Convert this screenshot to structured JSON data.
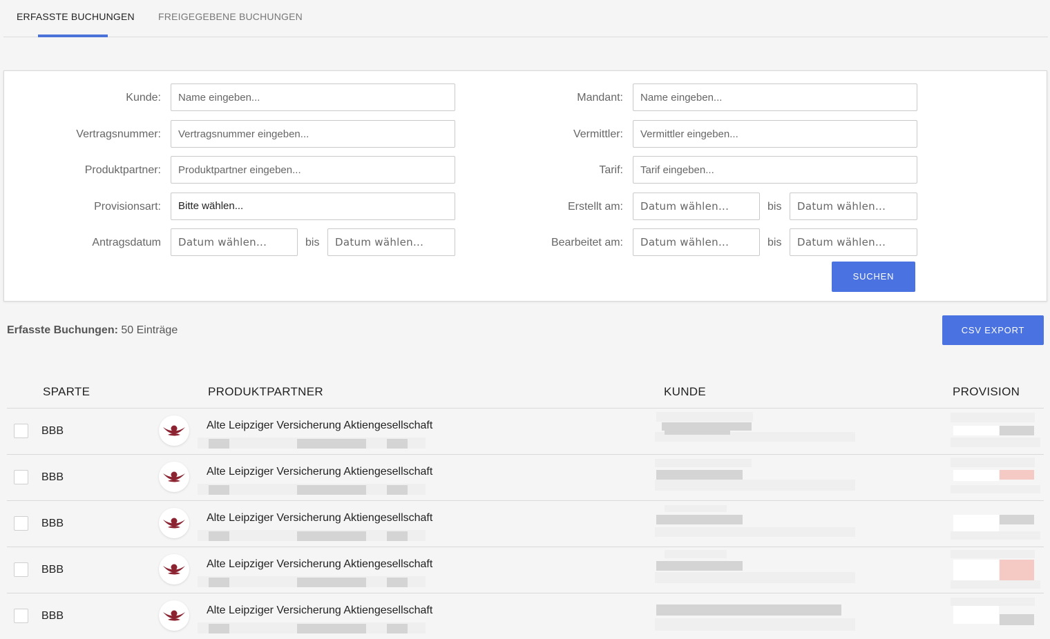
{
  "tabs": [
    {
      "label": "ERFASSTE BUCHUNGEN",
      "active": true
    },
    {
      "label": "FREIGEGEBENE BUCHUNGEN",
      "active": false
    }
  ],
  "filter": {
    "kunde": {
      "label": "Kunde:",
      "placeholder": "Name eingeben..."
    },
    "vertragsnummer": {
      "label": "Vertragsnummer:",
      "placeholder": "Vertragsnummer eingeben..."
    },
    "produktpartner": {
      "label": "Produktpartner:",
      "placeholder": "Produktpartner eingeben..."
    },
    "provisionsart": {
      "label": "Provisionsart:",
      "value": "Bitte wählen..."
    },
    "antragsdatum": {
      "label": "Antragsdatum",
      "from_placeholder": "Datum wählen...",
      "to_placeholder": "Datum wählen..."
    },
    "mandant": {
      "label": "Mandant:",
      "placeholder": "Name eingeben..."
    },
    "vermittler": {
      "label": "Vermittler:",
      "placeholder": "Vermittler eingeben..."
    },
    "tarif": {
      "label": "Tarif:",
      "placeholder": "Tarif eingeben..."
    },
    "erstellt_am": {
      "label": "Erstellt am:",
      "from_placeholder": "Datum wählen...",
      "to_placeholder": "Datum wählen..."
    },
    "bearbeitet_am": {
      "label": "Bearbeitet am:",
      "from_placeholder": "Datum wählen...",
      "to_placeholder": "Datum wählen..."
    },
    "bis_label": "bis",
    "search_button": "SUCHEN"
  },
  "summary": {
    "title": "Erfasste Buchungen:",
    "count_text": "50 Einträge"
  },
  "csv_button": "CSV EXPORT",
  "table": {
    "headers": {
      "sparte": "SPARTE",
      "produktpartner": "PRODUKTPARTNER",
      "kunde": "KUNDE",
      "provision": "PROVISION"
    },
    "rows": [
      {
        "sparte": "BBB",
        "partner": "Alte Leipziger Versicherung Aktiengesellschaft"
      },
      {
        "sparte": "BBB",
        "partner": "Alte Leipziger Versicherung Aktiengesellschaft"
      },
      {
        "sparte": "BBB",
        "partner": "Alte Leipziger Versicherung Aktiengesellschaft"
      },
      {
        "sparte": "BBB",
        "partner": "Alte Leipziger Versicherung Aktiengesellschaft"
      },
      {
        "sparte": "BBB",
        "partner": "Alte Leipziger Versicherung Aktiengesellschaft"
      }
    ]
  },
  "colors": {
    "accent": "#4a72e0",
    "logo": "#8b2331"
  }
}
